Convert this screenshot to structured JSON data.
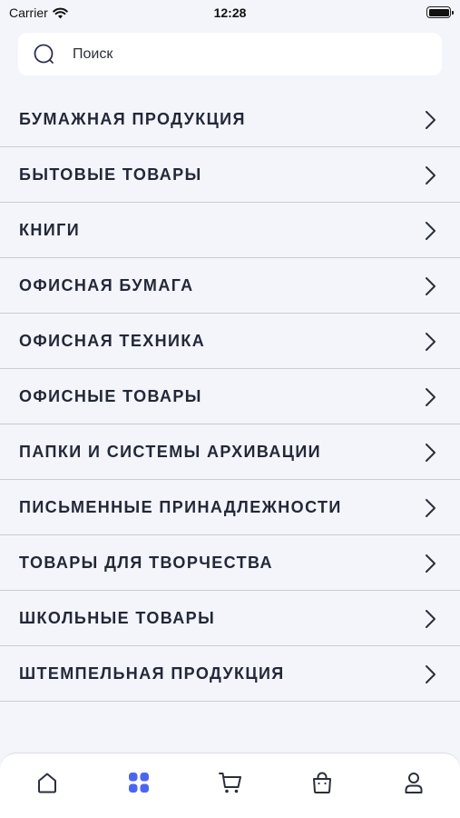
{
  "status_bar": {
    "carrier": "Carrier",
    "time": "12:28"
  },
  "search": {
    "placeholder": "Поиск",
    "icon": "search-icon"
  },
  "categories": [
    {
      "label": "БУМАЖНАЯ ПРОДУКЦИЯ"
    },
    {
      "label": "БЫТОВЫЕ ТОВАРЫ"
    },
    {
      "label": "КНИГИ"
    },
    {
      "label": "ОФИСНАЯ БУМАГА"
    },
    {
      "label": "ОФИСНАЯ ТЕХНИКА"
    },
    {
      "label": "ОФИСНЫЕ ТОВАРЫ"
    },
    {
      "label": "ПАПКИ И СИСТЕМЫ АРХИВАЦИИ"
    },
    {
      "label": "ПИСЬМЕННЫЕ ПРИНАДЛЕЖНОСТИ"
    },
    {
      "label": "ТОВАРЫ ДЛЯ ТВОРЧЕСТВА"
    },
    {
      "label": "ШКОЛЬНЫЕ ТОВАРЫ"
    },
    {
      "label": "ШТЕМПЕЛЬНАЯ ПРОДУКЦИЯ"
    }
  ],
  "tab_bar": {
    "tabs": [
      {
        "icon": "home-icon",
        "active": false
      },
      {
        "icon": "catalog-grid-icon",
        "active": true
      },
      {
        "icon": "cart-icon",
        "active": false
      },
      {
        "icon": "shopping-bag-icon",
        "active": false
      },
      {
        "icon": "profile-icon",
        "active": false
      }
    ],
    "active_color": "#4a66f0",
    "inactive_color": "#2b2f3a"
  }
}
